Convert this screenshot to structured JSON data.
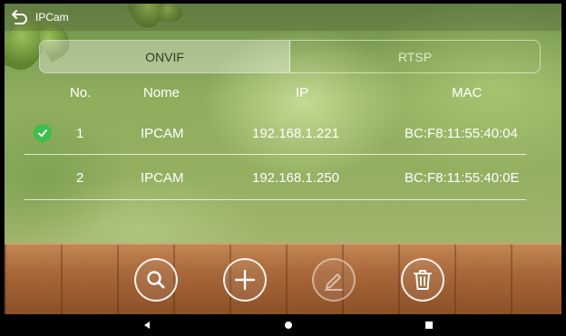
{
  "titlebar": {
    "title": "IPCam"
  },
  "tabs": [
    {
      "label": "ONVIF",
      "active": true
    },
    {
      "label": "RTSP",
      "active": false
    }
  ],
  "table": {
    "headers": {
      "no": "No.",
      "name": "Nome",
      "ip": "IP",
      "mac": "MAC"
    },
    "rows": [
      {
        "no": "1",
        "name": "IPCAM",
        "ip": "192.168.1.221",
        "mac": "BC:F8:11:55:40:04",
        "selected": true
      },
      {
        "no": "2",
        "name": "IPCAM",
        "ip": "192.168.1.250",
        "mac": "BC:F8:11:55:40:0E",
        "selected": false
      }
    ]
  },
  "toolbar": {
    "buttons": [
      {
        "icon": "search-icon",
        "enabled": true
      },
      {
        "icon": "plus-icon",
        "enabled": true
      },
      {
        "icon": "edit-icon",
        "enabled": false
      },
      {
        "icon": "trash-icon",
        "enabled": true
      }
    ]
  },
  "navbar": {
    "icons": [
      "back-triangle-icon",
      "home-circle-icon",
      "recents-square-icon"
    ]
  },
  "colors": {
    "check": "#3dbf4a",
    "accent_text": "#ffffff"
  }
}
